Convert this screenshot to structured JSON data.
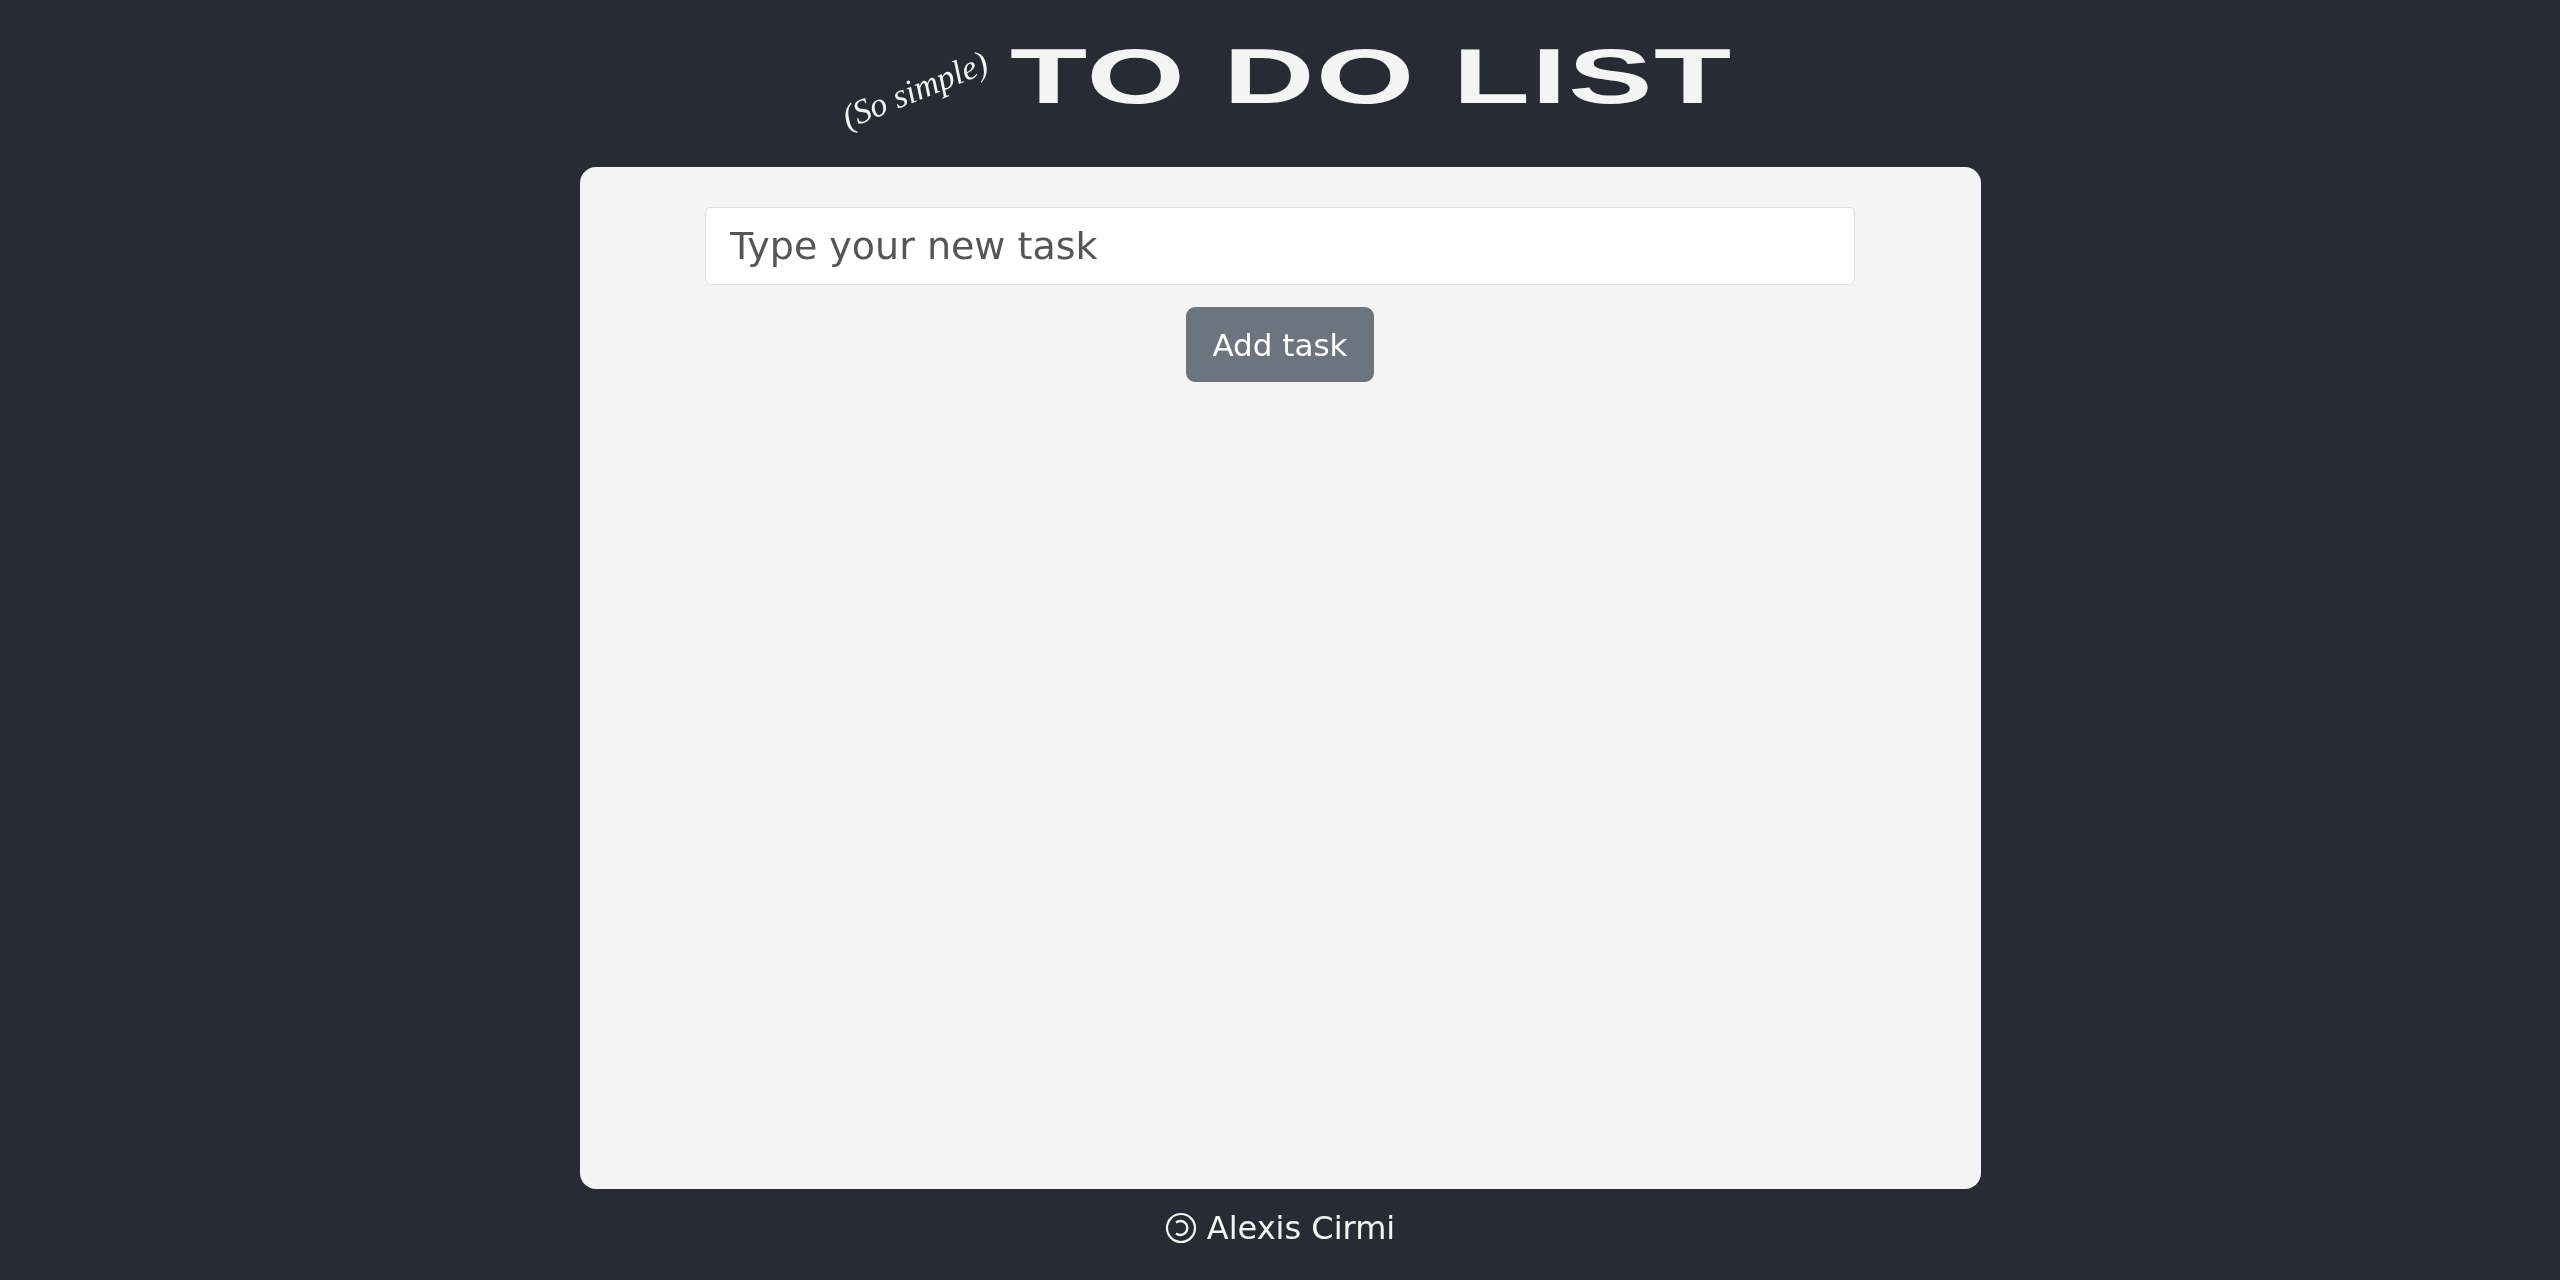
{
  "header": {
    "subtitle": "(So simple)",
    "title": "TO DO LIST"
  },
  "new_task": {
    "placeholder": "Type your new task",
    "button": "Add task"
  },
  "footer": {
    "author": "Alexis Cirmi"
  }
}
